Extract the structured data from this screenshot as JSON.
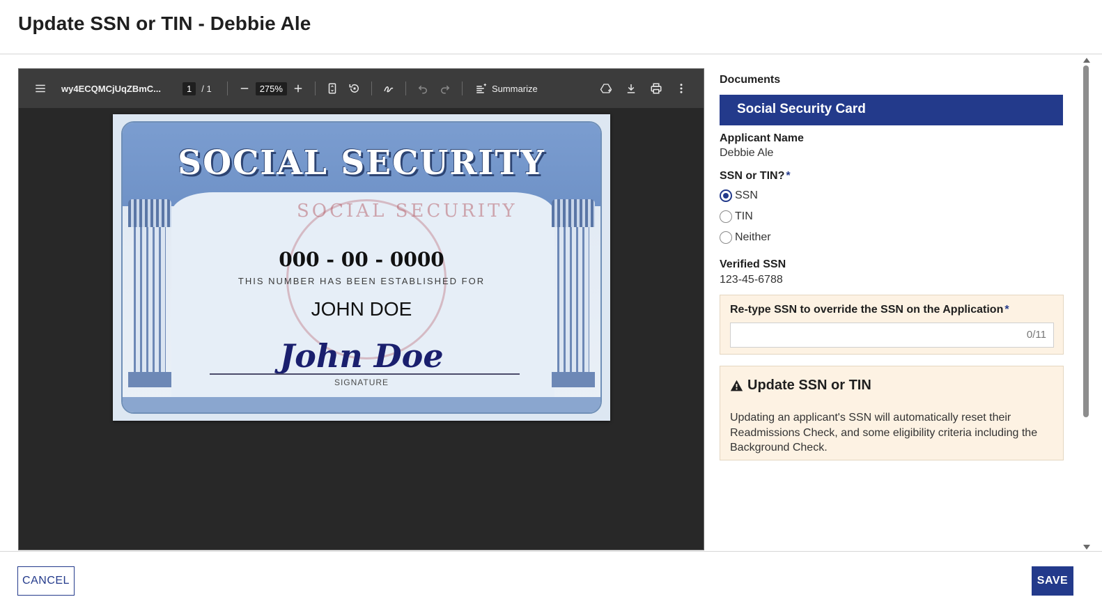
{
  "header": {
    "title": "Update SSN or TIN - Debbie Ale"
  },
  "viewer": {
    "filename": "wy4ECQMCjUqZBmC...",
    "page_current": "1",
    "page_total": "/ 1",
    "zoom": "275%",
    "summarize_label": "Summarize",
    "card": {
      "title": "SOCIAL SECURITY",
      "number": "000 - 00 - 0000",
      "established": "THIS NUMBER HAS BEEN ESTABLISHED FOR",
      "name": "JOHN DOE",
      "signature": "John Doe",
      "signature_label": "SIGNATURE",
      "seal_text": "SOCIAL SECURITY"
    }
  },
  "panel": {
    "documents_label": "Documents",
    "document_name": "Social Security Card",
    "applicant_name_label": "Applicant Name",
    "applicant_name_value": "Debbie Ale",
    "ssn_or_tin_label": "SSN or TIN?",
    "required_mark": "*",
    "radio_options": [
      {
        "label": "SSN",
        "checked": true
      },
      {
        "label": "TIN",
        "checked": false
      },
      {
        "label": "Neither",
        "checked": false
      }
    ],
    "verified_ssn_label": "Verified SSN",
    "verified_ssn_value": "123-45-6788",
    "override_label": "Re-type SSN to override the SSN on the Application",
    "override_value": "",
    "override_counter": "0/11",
    "warning_title": "Update SSN or TIN",
    "warning_text": "Updating an applicant's SSN will automatically reset their Readmissions Check, and some eligibility criteria including the Background Check."
  },
  "footer": {
    "cancel_label": "CANCEL",
    "save_label": "SAVE"
  },
  "colors": {
    "brand": "#233a8b",
    "warning_bg": "#fdf2e3",
    "viewer_bg": "#282828",
    "toolbar_bg": "#3c3c3c"
  },
  "icons": [
    "menu-icon",
    "minus-icon",
    "plus-icon",
    "fit-page-icon",
    "rotate-icon",
    "draw-icon",
    "undo-icon",
    "redo-icon",
    "summarize-icon",
    "drive-icon",
    "download-icon",
    "print-icon",
    "more-icon",
    "warning-icon"
  ]
}
